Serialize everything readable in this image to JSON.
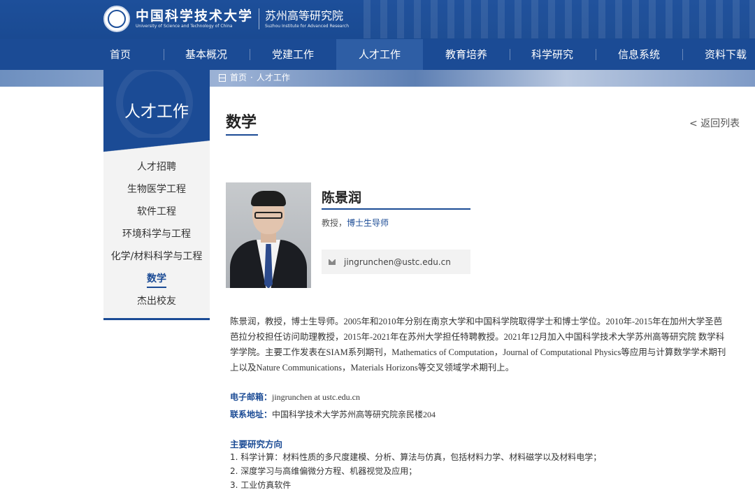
{
  "header": {
    "school_cn": "中国科学技术大学",
    "school_en": "University of Science and Technology of China",
    "institute_cn": "苏州高等研究院",
    "institute_en": "Suzhou Institute for Advanced Research"
  },
  "nav": {
    "items": [
      "首页",
      "基本概况",
      "党建工作",
      "人才工作",
      "教育培养",
      "科学研究",
      "信息系统",
      "资料下载"
    ],
    "active": "人才工作"
  },
  "breadcrumb": {
    "home": "首页",
    "separator": "·",
    "current": "人才工作"
  },
  "sidebar": {
    "title": "人才工作",
    "items": [
      "人才招聘",
      "生物医学工程",
      "软件工程",
      "环境科学与工程",
      "化学/材料科学与工程",
      "数学",
      "杰出校友"
    ],
    "active": "数学"
  },
  "content": {
    "title": "数学",
    "back_label": "< 返回列表",
    "profile": {
      "name": "陈景润",
      "role_prefix": "教授，",
      "role_highlight": "博士生导师",
      "email": "jingrunchen@ustc.edu.cn"
    },
    "bio": "陈景润，教授，博士生导师。2005年和2010年分别在南京大学和中国科学院取得学士和博士学位。2010年-2015年在加州大学圣芭芭拉分校担任访问助理教授，2015年-2021年在苏州大学担任特聘教授。2021年12月加入中国科学技术大学苏州高等研究院 数学科学学院。主要工作发表在SIAM系列期刊，Mathematics of Computation，Journal of Computational Physics等应用与计算数学学术期刊上以及Nature Communications，Materials Horizons等交叉领域学术期刊上。",
    "contact": {
      "email_label": "电子邮箱：",
      "email_value": "jingrunchen at ustc.edu.cn",
      "address_label": "联系地址：",
      "address_value": "中国科学技术大学苏州高等研究院亲民楼204"
    },
    "research": {
      "title": "主要研究方向",
      "items": [
        "1. 科学计算：材料性质的多尺度建模、分析、算法与仿真，包括材料力学、材料磁学以及材料电学；",
        "2. 深度学习与高维偏微分方程、机器视觉及应用；",
        "3. 工业仿真软件"
      ]
    }
  },
  "colors": {
    "primary": "#1b4b95",
    "nav_active": "#2e5ea5",
    "sidebar_bg": "#f3f3f3"
  },
  "icons": {
    "breadcrumb": "home-icon",
    "email": "mail-icon"
  }
}
